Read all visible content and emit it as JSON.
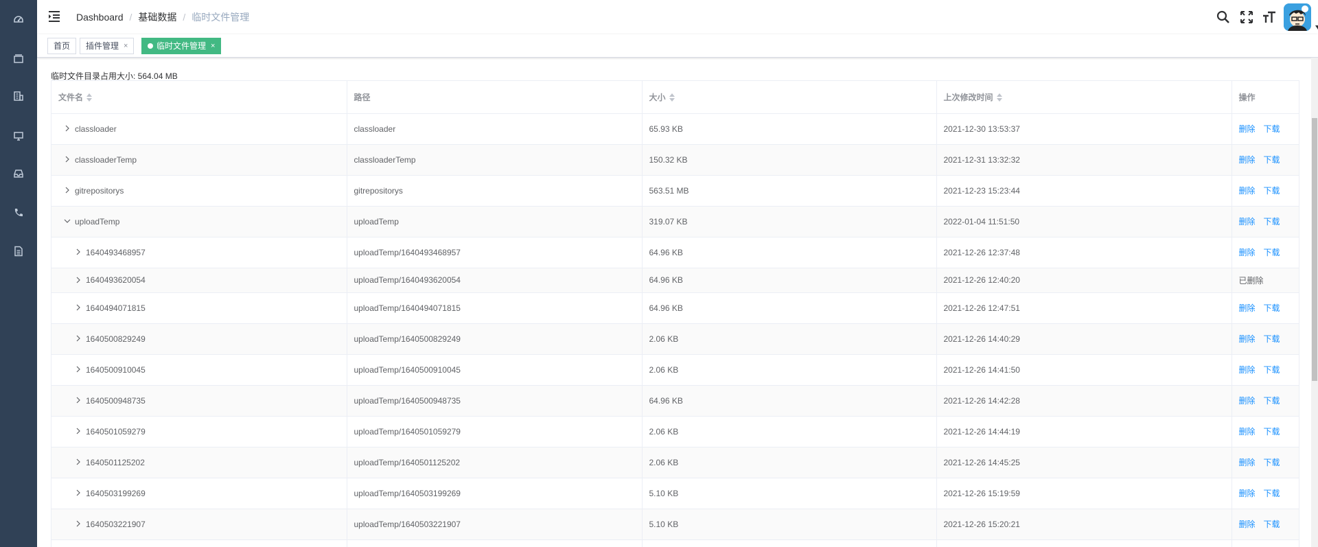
{
  "colors": {
    "sidebar": "#304156",
    "active_tag": "#42b983",
    "link": "#1890ff"
  },
  "sidebar": {
    "items": [
      {
        "icon": "dashboard-icon"
      },
      {
        "icon": "archive-icon"
      },
      {
        "icon": "building-icon"
      },
      {
        "icon": "monitor-icon"
      },
      {
        "icon": "inbox-icon"
      },
      {
        "icon": "phone-icon"
      },
      {
        "icon": "document-icon"
      }
    ]
  },
  "navbar": {
    "breadcrumb": [
      "Dashboard",
      "基础数据",
      "临时文件管理"
    ],
    "tools": [
      "search-icon",
      "fullscreen-icon",
      "font-size-icon"
    ]
  },
  "tags": [
    {
      "label": "首页",
      "closable": false,
      "active": false
    },
    {
      "label": "插件管理",
      "closable": true,
      "active": false
    },
    {
      "label": "临时文件管理",
      "closable": true,
      "active": true
    }
  ],
  "summary": "临时文件目录占用大小: 564.04 MB",
  "table": {
    "columns": [
      "文件名",
      "路径",
      "大小",
      "上次修改时间",
      "操作"
    ],
    "action_delete": "删除",
    "action_download": "下载",
    "deleted_label": "已删除",
    "close_mark": "×",
    "rows": [
      {
        "name": "classloader",
        "path": "classloader",
        "size": "65.93 KB",
        "time": "2021-12-30 13:53:37",
        "level": 0,
        "expanded": false,
        "deleted": false
      },
      {
        "name": "classloaderTemp",
        "path": "classloaderTemp",
        "size": "150.32 KB",
        "time": "2021-12-31 13:32:32",
        "level": 0,
        "expanded": false,
        "deleted": false
      },
      {
        "name": "gitrepositorys",
        "path": "gitrepositorys",
        "size": "563.51 MB",
        "time": "2021-12-23 15:23:44",
        "level": 0,
        "expanded": false,
        "deleted": false
      },
      {
        "name": "uploadTemp",
        "path": "uploadTemp",
        "size": "319.07 KB",
        "time": "2022-01-04 11:51:50",
        "level": 0,
        "expanded": true,
        "deleted": false
      },
      {
        "name": "1640493468957",
        "path": "uploadTemp/1640493468957",
        "size": "64.96 KB",
        "time": "2021-12-26 12:37:48",
        "level": 1,
        "expanded": false,
        "deleted": false
      },
      {
        "name": "1640493620054",
        "path": "uploadTemp/1640493620054",
        "size": "64.96 KB",
        "time": "2021-12-26 12:40:20",
        "level": 1,
        "expanded": false,
        "deleted": true
      },
      {
        "name": "1640494071815",
        "path": "uploadTemp/1640494071815",
        "size": "64.96 KB",
        "time": "2021-12-26 12:47:51",
        "level": 1,
        "expanded": false,
        "deleted": false
      },
      {
        "name": "1640500829249",
        "path": "uploadTemp/1640500829249",
        "size": "2.06 KB",
        "time": "2021-12-26 14:40:29",
        "level": 1,
        "expanded": false,
        "deleted": false
      },
      {
        "name": "1640500910045",
        "path": "uploadTemp/1640500910045",
        "size": "2.06 KB",
        "time": "2021-12-26 14:41:50",
        "level": 1,
        "expanded": false,
        "deleted": false
      },
      {
        "name": "1640500948735",
        "path": "uploadTemp/1640500948735",
        "size": "64.96 KB",
        "time": "2021-12-26 14:42:28",
        "level": 1,
        "expanded": false,
        "deleted": false
      },
      {
        "name": "1640501059279",
        "path": "uploadTemp/1640501059279",
        "size": "2.06 KB",
        "time": "2021-12-26 14:44:19",
        "level": 1,
        "expanded": false,
        "deleted": false
      },
      {
        "name": "1640501125202",
        "path": "uploadTemp/1640501125202",
        "size": "2.06 KB",
        "time": "2021-12-26 14:45:25",
        "level": 1,
        "expanded": false,
        "deleted": false
      },
      {
        "name": "1640503199269",
        "path": "uploadTemp/1640503199269",
        "size": "5.10 KB",
        "time": "2021-12-26 15:19:59",
        "level": 1,
        "expanded": false,
        "deleted": false
      },
      {
        "name": "1640503221907",
        "path": "uploadTemp/1640503221907",
        "size": "5.10 KB",
        "time": "2021-12-26 15:20:21",
        "level": 1,
        "expanded": false,
        "deleted": false
      },
      {
        "name": "",
        "path": "",
        "size": "",
        "time": "",
        "level": 1,
        "expanded": false,
        "deleted": false,
        "partial": true
      }
    ]
  }
}
